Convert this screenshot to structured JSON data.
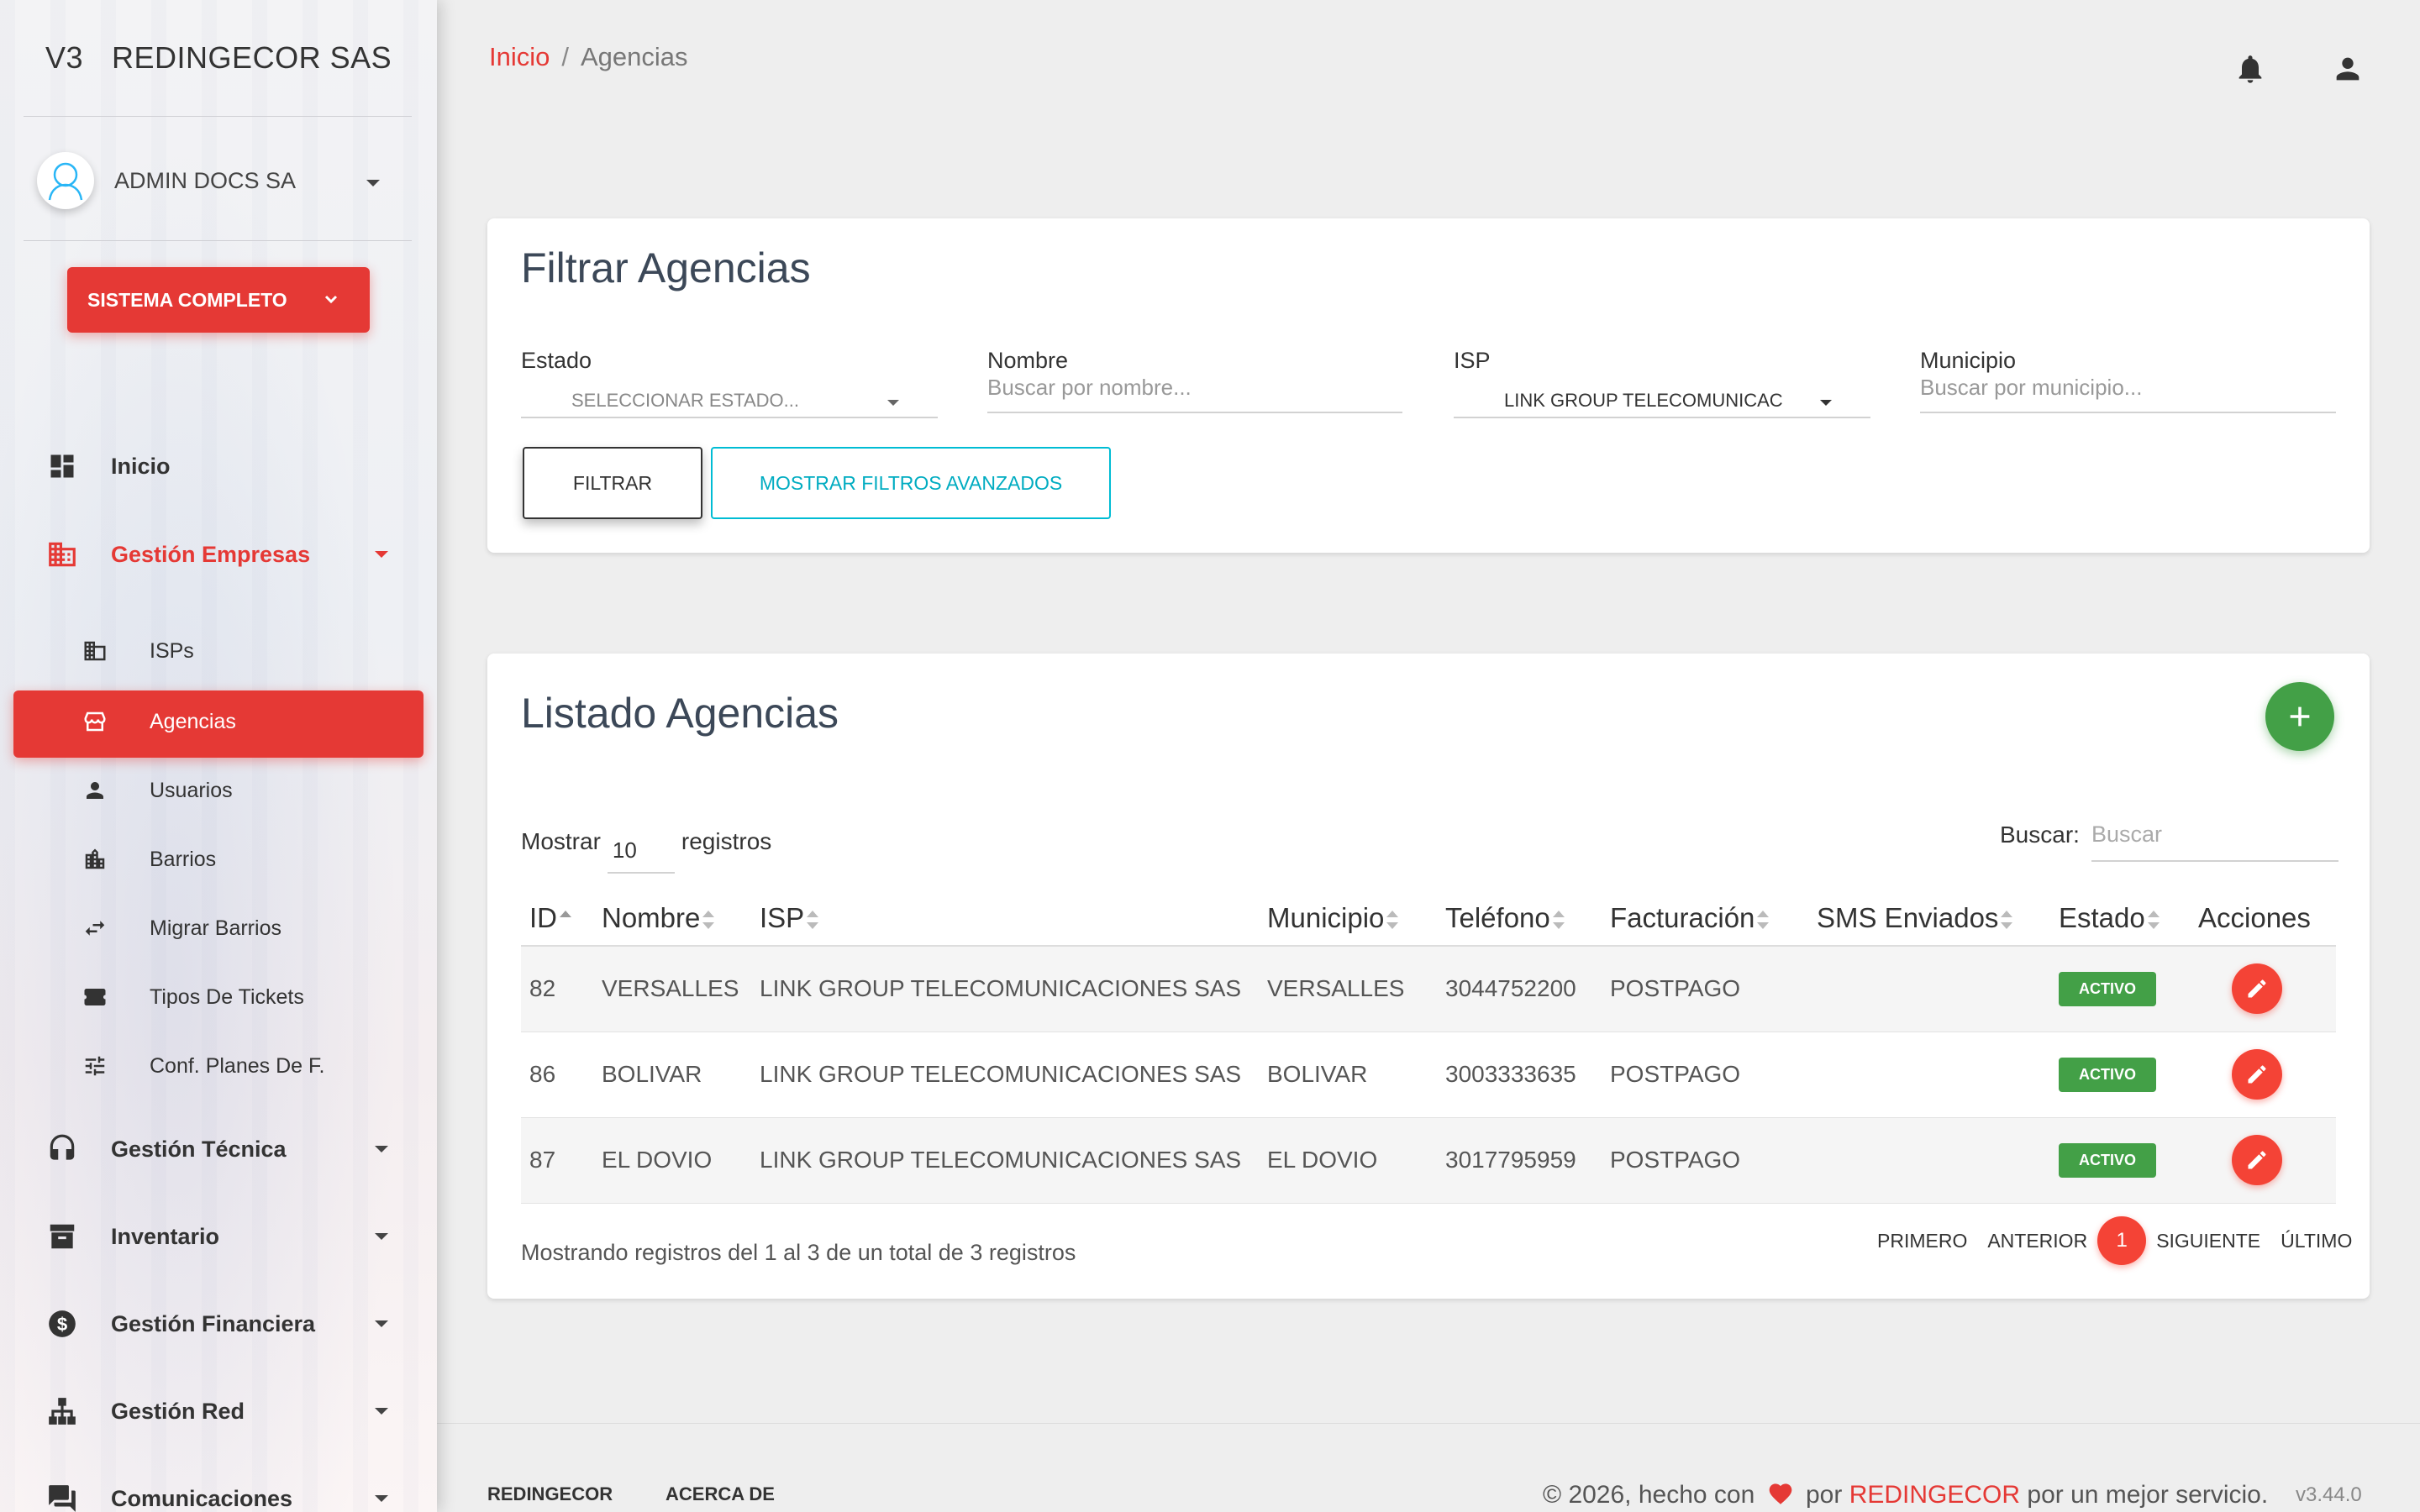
{
  "sidebar": {
    "brand_version": "V3",
    "brand_name": "REDINGECOR SAS",
    "user_name": "ADMIN DOCS SA",
    "system_button": "SISTEMA COMPLETO",
    "nav": {
      "inicio": "Inicio",
      "gestion_empresas": "Gestión Empresas",
      "gestion_tecnica": "Gestión Técnica",
      "inventario": "Inventario",
      "gestion_financiera": "Gestión Financiera",
      "gestion_red": "Gestión Red",
      "comunicaciones": "Comunicaciones"
    },
    "sub": {
      "isps": "ISPs",
      "agencias": "Agencias",
      "usuarios": "Usuarios",
      "barrios": "Barrios",
      "migrar_barrios": "Migrar Barrios",
      "tipos_tickets": "Tipos De Tickets",
      "conf_planes": "Conf. Planes De F."
    }
  },
  "breadcrumb": {
    "home": "Inicio",
    "separator": "/",
    "current": "Agencias"
  },
  "filter": {
    "title": "Filtrar Agencias",
    "estado_label": "Estado",
    "estado_value": "SELECCIONAR ESTADO...",
    "nombre_label": "Nombre",
    "nombre_placeholder": "Buscar por nombre...",
    "isp_label": "ISP",
    "isp_value": "LINK GROUP TELECOMUNICAC",
    "municipio_label": "Municipio",
    "municipio_placeholder": "Buscar por municipio...",
    "filtrar_button": "FILTRAR",
    "advanced_button": "MOSTRAR FILTROS AVANZADOS"
  },
  "listing": {
    "title": "Listado Agencias",
    "show_label": "Mostrar",
    "show_value": "10",
    "records_label": "registros",
    "search_label": "Buscar:",
    "search_placeholder": "Buscar",
    "columns": [
      "ID",
      "Nombre",
      "ISP",
      "Municipio",
      "Teléfono",
      "Facturación",
      "SMS Enviados",
      "Estado",
      "Acciones"
    ],
    "rows": [
      {
        "id": "82",
        "nombre": "VERSALLES",
        "isp": "LINK GROUP TELECOMUNICACIONES SAS",
        "municipio": "VERSALLES",
        "telefono": "3044752200",
        "facturacion": "POSTPAGO",
        "sms": "",
        "estado": "ACTIVO"
      },
      {
        "id": "86",
        "nombre": "BOLIVAR",
        "isp": "LINK GROUP TELECOMUNICACIONES SAS",
        "municipio": "BOLIVAR",
        "telefono": "3003333635",
        "facturacion": "POSTPAGO",
        "sms": "",
        "estado": "ACTIVO"
      },
      {
        "id": "87",
        "nombre": "EL DOVIO",
        "isp": "LINK GROUP TELECOMUNICACIONES SAS",
        "municipio": "EL DOVIO",
        "telefono": "3017795959",
        "facturacion": "POSTPAGO",
        "sms": "",
        "estado": "ACTIVO"
      }
    ],
    "info": "Mostrando registros del 1 al 3 de un total de 3 registros",
    "pager": {
      "first": "PRIMERO",
      "prev": "ANTERIOR",
      "current": "1",
      "next": "SIGUIENTE",
      "last": "ÚLTIMO"
    }
  },
  "footer": {
    "link1": "REDINGECOR",
    "link2": "ACERCA DE",
    "copy_pre": "© 2026, hecho con",
    "copy_por": "por",
    "copy_brand": "REDINGECOR",
    "copy_post": "por un mejor servicio.",
    "version": "v3.44.0"
  },
  "colors": {
    "accent": "#e53935",
    "success": "#43a047",
    "info": "#00bcd4",
    "background": "#eeeeee"
  }
}
